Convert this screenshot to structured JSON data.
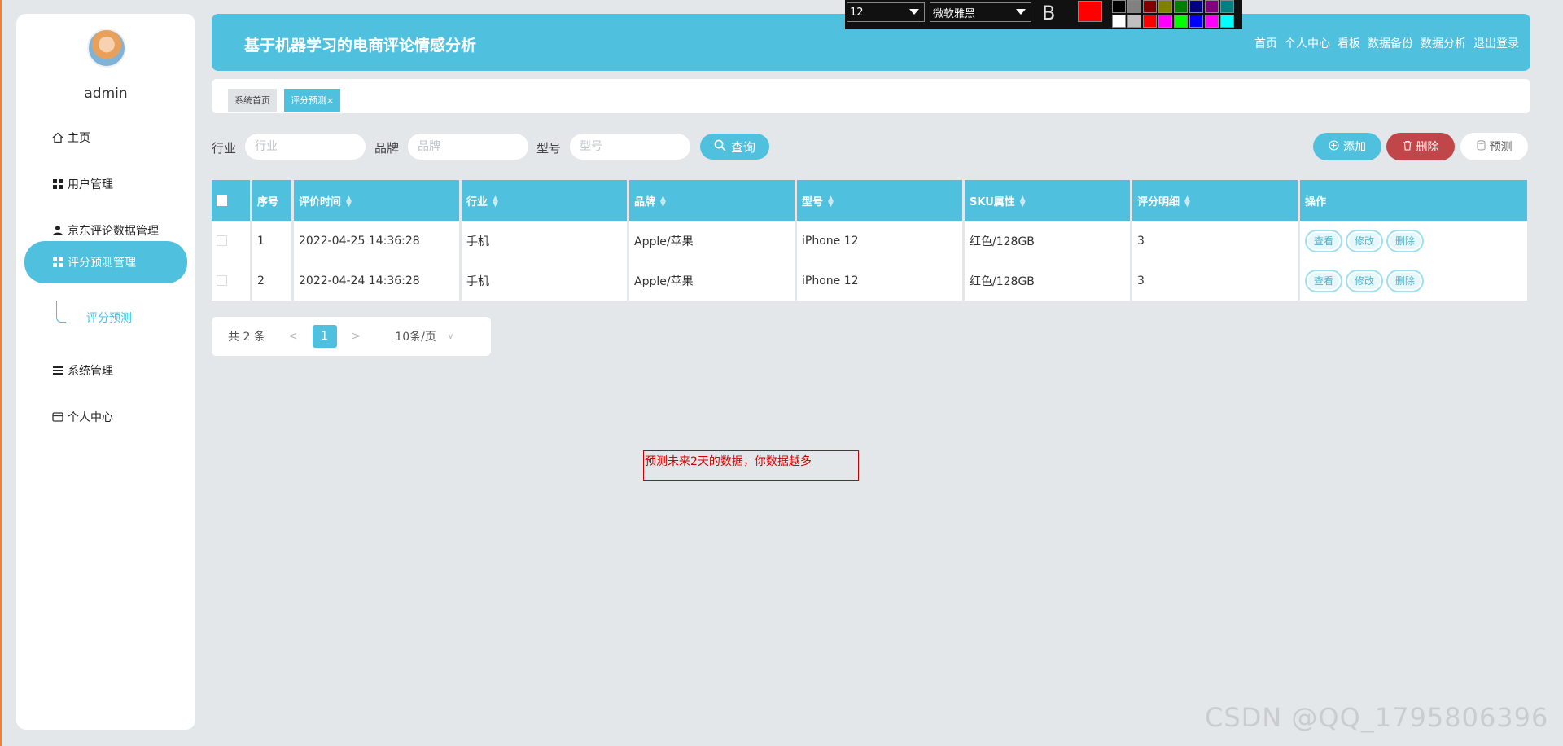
{
  "sidebar": {
    "admin": "admin",
    "items": [
      {
        "label": "主页",
        "icon": "home-icon"
      },
      {
        "label": "用户管理",
        "icon": "grid-icon"
      },
      {
        "label": "京东评论数据管理",
        "icon": "user-icon"
      },
      {
        "label": "评分预测管理",
        "icon": "grid-icon"
      },
      {
        "label": "系统管理",
        "icon": "list-icon"
      },
      {
        "label": "个人中心",
        "icon": "card-icon"
      }
    ],
    "sub_item": "评分预测"
  },
  "header": {
    "title": "基于机器学习的电商评论情感分析",
    "nav": [
      "首页",
      "个人中心",
      "看板",
      "数据备份",
      "数据分析",
      "退出登录"
    ]
  },
  "tabs": {
    "home": "系统首页",
    "current": "评分预测×"
  },
  "search": {
    "industry_label": "行业",
    "industry_placeholder": "行业",
    "brand_label": "品牌",
    "brand_placeholder": "品牌",
    "model_label": "型号",
    "model_placeholder": "型号",
    "query_button": "查询"
  },
  "actions": {
    "add": "添加",
    "delete": "删除",
    "predict": "预测"
  },
  "table": {
    "headers": [
      "序号",
      "评价时间",
      "行业",
      "品牌",
      "型号",
      "SKU属性",
      "评分明细",
      "操作"
    ],
    "rows": [
      {
        "no": "1",
        "time": "2022-04-25 14:36:28",
        "industry": "手机",
        "brand": "Apple/苹果",
        "model": "iPhone 12",
        "sku": "红色/128GB",
        "score": "3"
      },
      {
        "no": "2",
        "time": "2022-04-24 14:36:28",
        "industry": "手机",
        "brand": "Apple/苹果",
        "model": "iPhone 12",
        "sku": "红色/128GB",
        "score": "3"
      }
    ],
    "op_view": "查看",
    "op_edit": "修改",
    "op_delete": "删除"
  },
  "pager": {
    "total": "共 2 条",
    "current_page": "1",
    "page_size": "10条/页"
  },
  "annotation": "预测未来2天的数据，你数据越多",
  "format_toolbar": {
    "font_size": "12",
    "font_name": "微软雅黑",
    "bold": "B",
    "current_color": "#ff0000",
    "palette": [
      "#000000",
      "#808080",
      "#800000",
      "#808000",
      "#008000",
      "#000080",
      "#800080",
      "#008080",
      "#ffffff",
      "#c0c0c0",
      "#ff0000",
      "#ff00ff",
      "#00ff00",
      "#0000ff",
      "#ff00ff",
      "#00ffff"
    ]
  },
  "watermark": "CSDN @QQ_1795806396",
  "colors": {
    "accent": "#4fc0dd",
    "danger": "#c0464a"
  }
}
